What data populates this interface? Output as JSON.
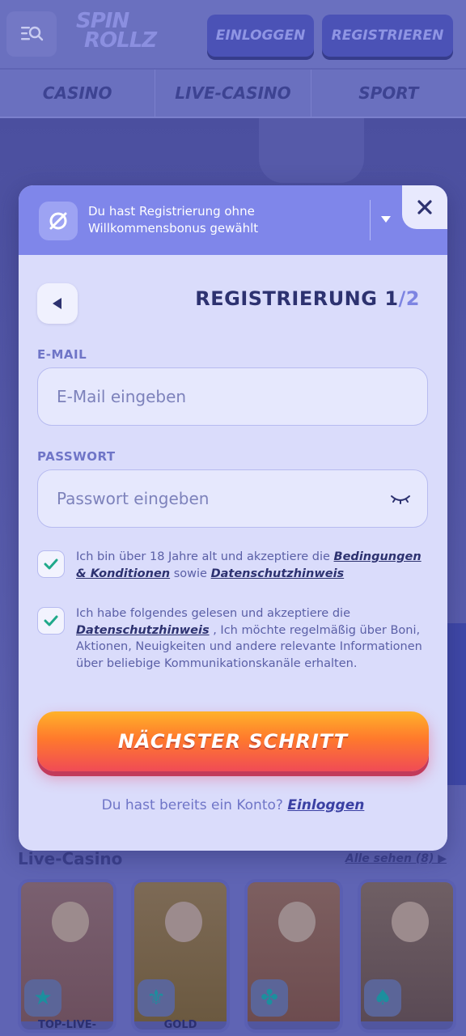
{
  "header": {
    "logo_line1": "SPIN",
    "logo_line2": "ROLLZ",
    "login_label": "EINLOGGEN",
    "register_label": "REGISTRIEREN"
  },
  "nav": {
    "tabs": [
      {
        "label": "CASINO"
      },
      {
        "label": "LIVE-CASINO"
      },
      {
        "label": "SPORT"
      }
    ]
  },
  "live_casino": {
    "title": "Live-Casino",
    "see_all": "Alle sehen (8) ▶",
    "games": [
      {
        "name": "TOP-LIVE-",
        "icon": "star-icon",
        "glyph": "★"
      },
      {
        "name": "GOLD",
        "icon": "fleur-de-lis-icon",
        "glyph": "⚜"
      },
      {
        "name": "",
        "icon": "clover-icon",
        "glyph": "✤"
      },
      {
        "name": "",
        "icon": "spade-icon",
        "glyph": "♠"
      }
    ]
  },
  "modal": {
    "bonus_notice": "Du hast Registrierung ohne Willkommensbonus gewählt",
    "title": "REGISTRIERUNG 1",
    "title_step": "/2",
    "email": {
      "label": "E-MAIL",
      "placeholder": "E-Mail eingeben",
      "value": ""
    },
    "password": {
      "label": "PASSWORT",
      "placeholder": "Passwort eingeben",
      "value": ""
    },
    "terms": {
      "text_before": "Ich bin über 18 Jahre alt und akzeptiere die ",
      "link_terms": "Bedingungen & Konditionen",
      "text_mid": " sowie ",
      "link_privacy": "Datenschutzhinweis",
      "checked": true
    },
    "marketing": {
      "text_before": "Ich habe folgendes gelesen und akzeptiere die ",
      "link_privacy": "Datenschutzhinweis",
      "text_after": " , Ich möchte regelmäßig über Boni, Aktionen, Neuigkeiten und andere relevante Informationen über beliebige Kommunikationskanäle erhalten.",
      "checked": true
    },
    "next_button": "NÄCHSTER SCHRITT",
    "have_account": "Du hast bereits ein Konto? ",
    "login_link": "Einloggen"
  },
  "colors": {
    "accent": "#7f86ea",
    "text_dark": "#2d3270",
    "check_green": "#1fa98a",
    "button_orange": "#ff7a2c",
    "button_pink": "#f04b56"
  }
}
